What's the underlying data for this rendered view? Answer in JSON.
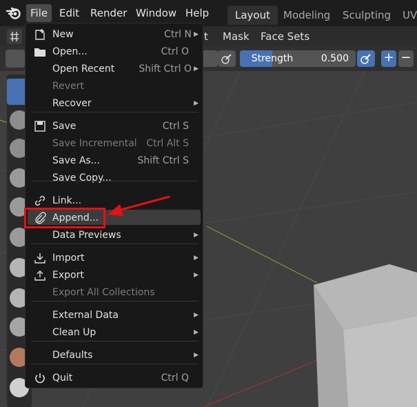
{
  "topbar": {
    "menus": [
      "File",
      "Edit",
      "Render",
      "Window",
      "Help"
    ],
    "tabs": [
      "Layout",
      "Modeling",
      "Sculpting",
      "UV"
    ]
  },
  "header": {
    "items": [
      "t",
      "Mask",
      "Face Sets"
    ]
  },
  "tool_settings": {
    "strength_label": "Strength",
    "strength_value": "0.500",
    "strength_fraction": 0.5,
    "plus": "+",
    "minus": "−"
  },
  "file_menu": {
    "items": [
      {
        "label": "New",
        "shortcut": "Ctrl N",
        "icon": "new-file-icon",
        "submenu": true,
        "enabled": true
      },
      {
        "label": "Open...",
        "shortcut": "Ctrl O",
        "icon": "folder-open-icon",
        "submenu": false,
        "enabled": true
      },
      {
        "label": "Open Recent",
        "shortcut": "Shift Ctrl O",
        "icon": "",
        "submenu": true,
        "enabled": true
      },
      {
        "label": "Revert",
        "shortcut": "",
        "icon": "",
        "submenu": false,
        "enabled": false
      },
      {
        "label": "Recover",
        "shortcut": "",
        "icon": "",
        "submenu": true,
        "enabled": true
      },
      {
        "label": "Save",
        "shortcut": "Ctrl S",
        "icon": "save-icon",
        "submenu": false,
        "enabled": true
      },
      {
        "label": "Save Incremental",
        "shortcut": "Ctrl Alt S",
        "icon": "",
        "submenu": false,
        "enabled": false
      },
      {
        "label": "Save As...",
        "shortcut": "Shift Ctrl S",
        "icon": "",
        "submenu": false,
        "enabled": true
      },
      {
        "label": "Save Copy...",
        "shortcut": "",
        "icon": "",
        "submenu": false,
        "enabled": true
      },
      {
        "label": "Link...",
        "shortcut": "",
        "icon": "link-icon",
        "submenu": false,
        "enabled": true
      },
      {
        "label": "Append...",
        "shortcut": "",
        "icon": "paperclip-icon",
        "submenu": false,
        "enabled": true,
        "highlighted": true
      },
      {
        "label": "Data Previews",
        "shortcut": "",
        "icon": "",
        "submenu": true,
        "enabled": true
      },
      {
        "label": "Import",
        "shortcut": "",
        "icon": "import-icon",
        "submenu": true,
        "enabled": true
      },
      {
        "label": "Export",
        "shortcut": "",
        "icon": "export-icon",
        "submenu": true,
        "enabled": true
      },
      {
        "label": "Export All Collections",
        "shortcut": "",
        "icon": "",
        "submenu": false,
        "enabled": false
      },
      {
        "label": "External Data",
        "shortcut": "",
        "icon": "",
        "submenu": true,
        "enabled": true
      },
      {
        "label": "Clean Up",
        "shortcut": "",
        "icon": "",
        "submenu": true,
        "enabled": true
      },
      {
        "label": "Defaults",
        "shortcut": "",
        "icon": "",
        "submenu": true,
        "enabled": true
      },
      {
        "label": "Quit",
        "shortcut": "Ctrl Q",
        "icon": "power-icon",
        "submenu": false,
        "enabled": true
      }
    ]
  },
  "colors": {
    "accent": "#4772b3",
    "annotation": "#e81010",
    "highlight": "#3c3c3c"
  }
}
